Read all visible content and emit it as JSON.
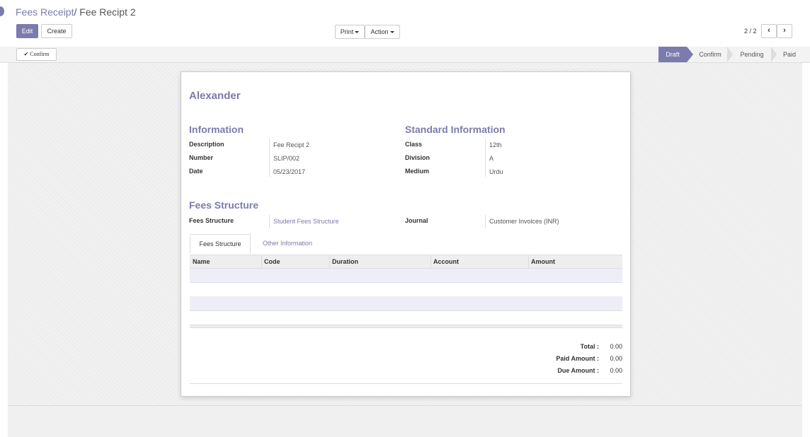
{
  "breadcrumb": {
    "parent": "Fees Receipt",
    "separator": "/",
    "current": "Fee Recipt 2"
  },
  "toolbar": {
    "edit_label": "Edit",
    "create_label": "Create",
    "print_label": "Print",
    "action_label": "Action"
  },
  "pager": {
    "text": "2 / 2",
    "prev_icon": "chevron-left-icon",
    "next_icon": "chevron-right-icon"
  },
  "statusbar": {
    "confirm_button": "Confirm",
    "confirm_icon": "checkmark-icon",
    "stages": [
      "Draft",
      "Confirm",
      "Pending",
      "Paid"
    ],
    "active_stage": "Draft"
  },
  "form": {
    "student_name": "Alexander",
    "information": {
      "title": "Information",
      "fields": [
        {
          "label": "Description",
          "value": "Fee Recipt 2"
        },
        {
          "label": "Number",
          "value": "SLIP/002"
        },
        {
          "label": "Date",
          "value": "05/23/2017"
        }
      ]
    },
    "standard_information": {
      "title": "Standard Information",
      "fields": [
        {
          "label": "Class",
          "value": "12th"
        },
        {
          "label": "Division",
          "value": "A"
        },
        {
          "label": "Medium",
          "value": "Urdu"
        }
      ]
    },
    "fees_structure": {
      "title": "Fees Structure",
      "structure_label": "Fees Structure",
      "structure_value": "Student Fees Structure",
      "journal_label": "Journal",
      "journal_value": "Customer Invoices (INR)"
    },
    "tabs": [
      "Fees Structure",
      "Other Information"
    ],
    "table": {
      "columns": [
        "Name",
        "Code",
        "Duration",
        "Account",
        "Amount"
      ]
    },
    "totals": [
      {
        "label": "Total :",
        "value": "0.00"
      },
      {
        "label": "Paid Amount :",
        "value": "0.00"
      },
      {
        "label": "Due Amount :",
        "value": "0.00"
      }
    ]
  },
  "colors": {
    "accent": "#7c7bad"
  }
}
